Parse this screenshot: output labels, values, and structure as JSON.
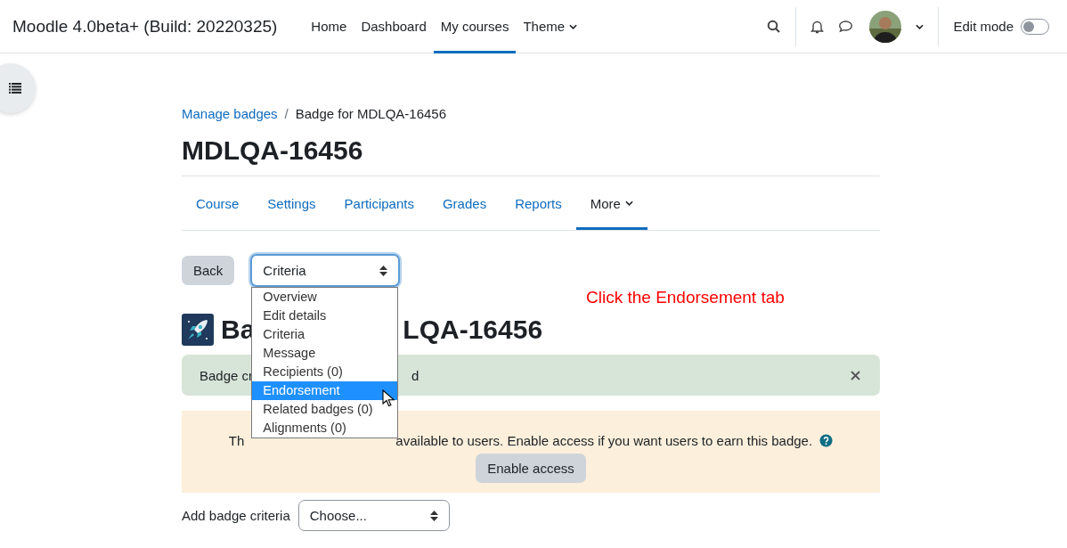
{
  "site_name": "Moodle 4.0beta+ (Build: 20220325)",
  "nav": [
    {
      "label": "Home",
      "selected": false,
      "dropdown": false
    },
    {
      "label": "Dashboard",
      "selected": false,
      "dropdown": false
    },
    {
      "label": "My courses",
      "selected": true,
      "dropdown": false
    },
    {
      "label": "Theme",
      "selected": false,
      "dropdown": true
    }
  ],
  "edit_mode": {
    "label": "Edit mode",
    "on": false
  },
  "breadcrumb_separator": "/",
  "breadcrumb": [
    {
      "label": "Manage badges",
      "kind": "link"
    },
    {
      "label": "Badge for MDLQA-16456",
      "kind": "current"
    }
  ],
  "title": "MDLQA-16456",
  "course_nav": [
    {
      "label": "Course",
      "selected": false,
      "dropdown": false
    },
    {
      "label": "Settings",
      "selected": false,
      "dropdown": false
    },
    {
      "label": "Participants",
      "selected": false,
      "dropdown": false
    },
    {
      "label": "Grades",
      "selected": false,
      "dropdown": false
    },
    {
      "label": "Reports",
      "selected": false,
      "dropdown": false
    },
    {
      "label": "More",
      "selected": true,
      "dropdown": true
    }
  ],
  "back_button": "Back",
  "page_select": {
    "value": "Criteria",
    "expanded": true,
    "options": [
      {
        "label": "Overview",
        "highlighted": false
      },
      {
        "label": "Edit details",
        "highlighted": false
      },
      {
        "label": "Criteria",
        "highlighted": false
      },
      {
        "label": "Message",
        "highlighted": false
      },
      {
        "label": "Recipients (0)",
        "highlighted": false
      },
      {
        "label": "Endorsement",
        "highlighted": true
      },
      {
        "label": "Related badges (0)",
        "highlighted": false
      },
      {
        "label": "Alignments (0)",
        "highlighted": false
      }
    ]
  },
  "annotation": "Click the Endorsement tab",
  "badge_heading": [
    "Ba",
    "LQA-16456"
  ],
  "alert": [
    "Badge cr",
    "d"
  ],
  "warning": {
    "texts": [
      "Th",
      "available to users. Enable access if you want users to earn this badge."
    ],
    "button": "Enable access"
  },
  "criteria": {
    "label": "Add badge criteria",
    "value": "Choose..."
  }
}
